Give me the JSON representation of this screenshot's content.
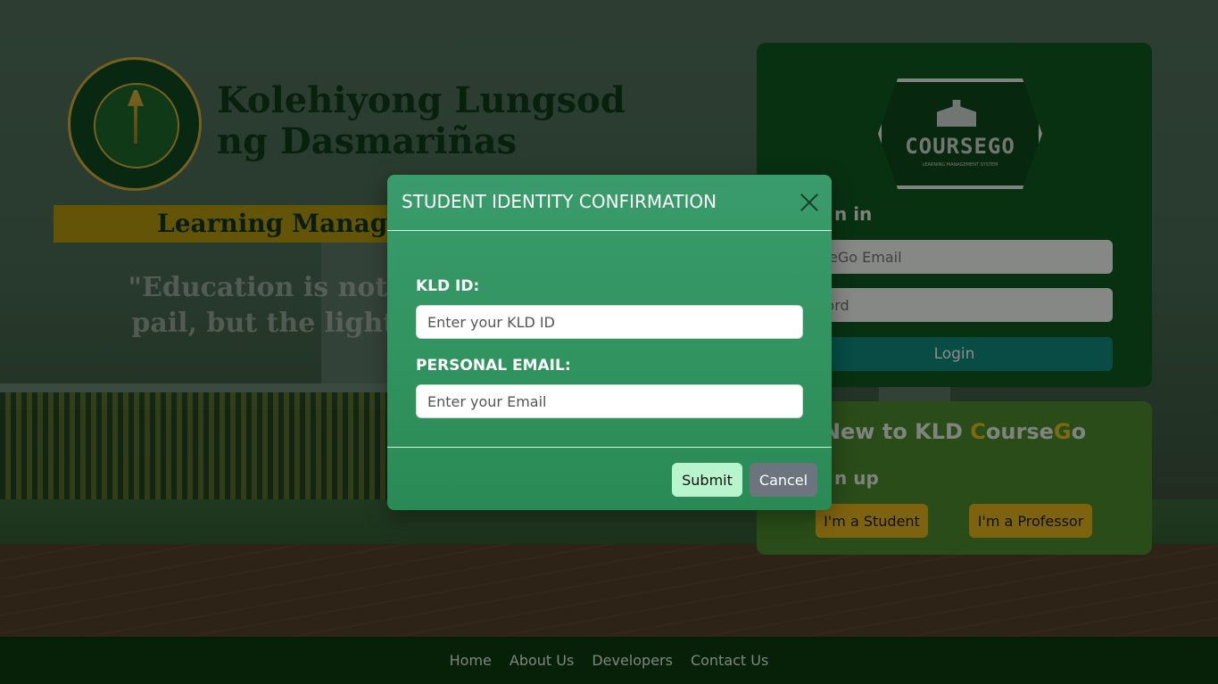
{
  "header": {
    "school_name": "Kolehiyong Lungsod ng Dasmariñas",
    "lms_banner": "Learning Manager",
    "quote": "\"Education is not t pail, but the lighti"
  },
  "login": {
    "logo_text": "COURSEGO",
    "logo_subtext": "LEARNING MANAGEMENT SYSTEM",
    "title_partial": "n in",
    "email_placeholder": "urseGo Email",
    "password_placeholder": "sword",
    "login_button": "Login"
  },
  "signup": {
    "heading_prefix": "New to KLD ",
    "heading_c": "C",
    "heading_ourse": "ourse",
    "heading_g": "G",
    "heading_o": "o",
    "title_partial": "n up",
    "student_button": "I'm a Student",
    "professor_button": "I'm a Professor"
  },
  "footer": {
    "links": [
      "Home",
      "About Us",
      "Developers",
      "Contact Us"
    ]
  },
  "modal": {
    "title": "STUDENT IDENTITY CONFIRMATION",
    "id_label": "KLD ID:",
    "id_placeholder": "Enter your KLD ID",
    "email_label": "PERSONAL EMAIL:",
    "email_placeholder": "Enter your Email",
    "submit": "Submit",
    "cancel": "Cancel"
  },
  "colors": {
    "modal_green": "#31935f",
    "submit_bg": "#b8f4cd",
    "cancel_bg": "#6c757d",
    "accent_gold": "#e6b51a"
  },
  "icons": {
    "close": "close-icon",
    "seal": "school-seal-icon",
    "coursego": "coursego-logo"
  }
}
